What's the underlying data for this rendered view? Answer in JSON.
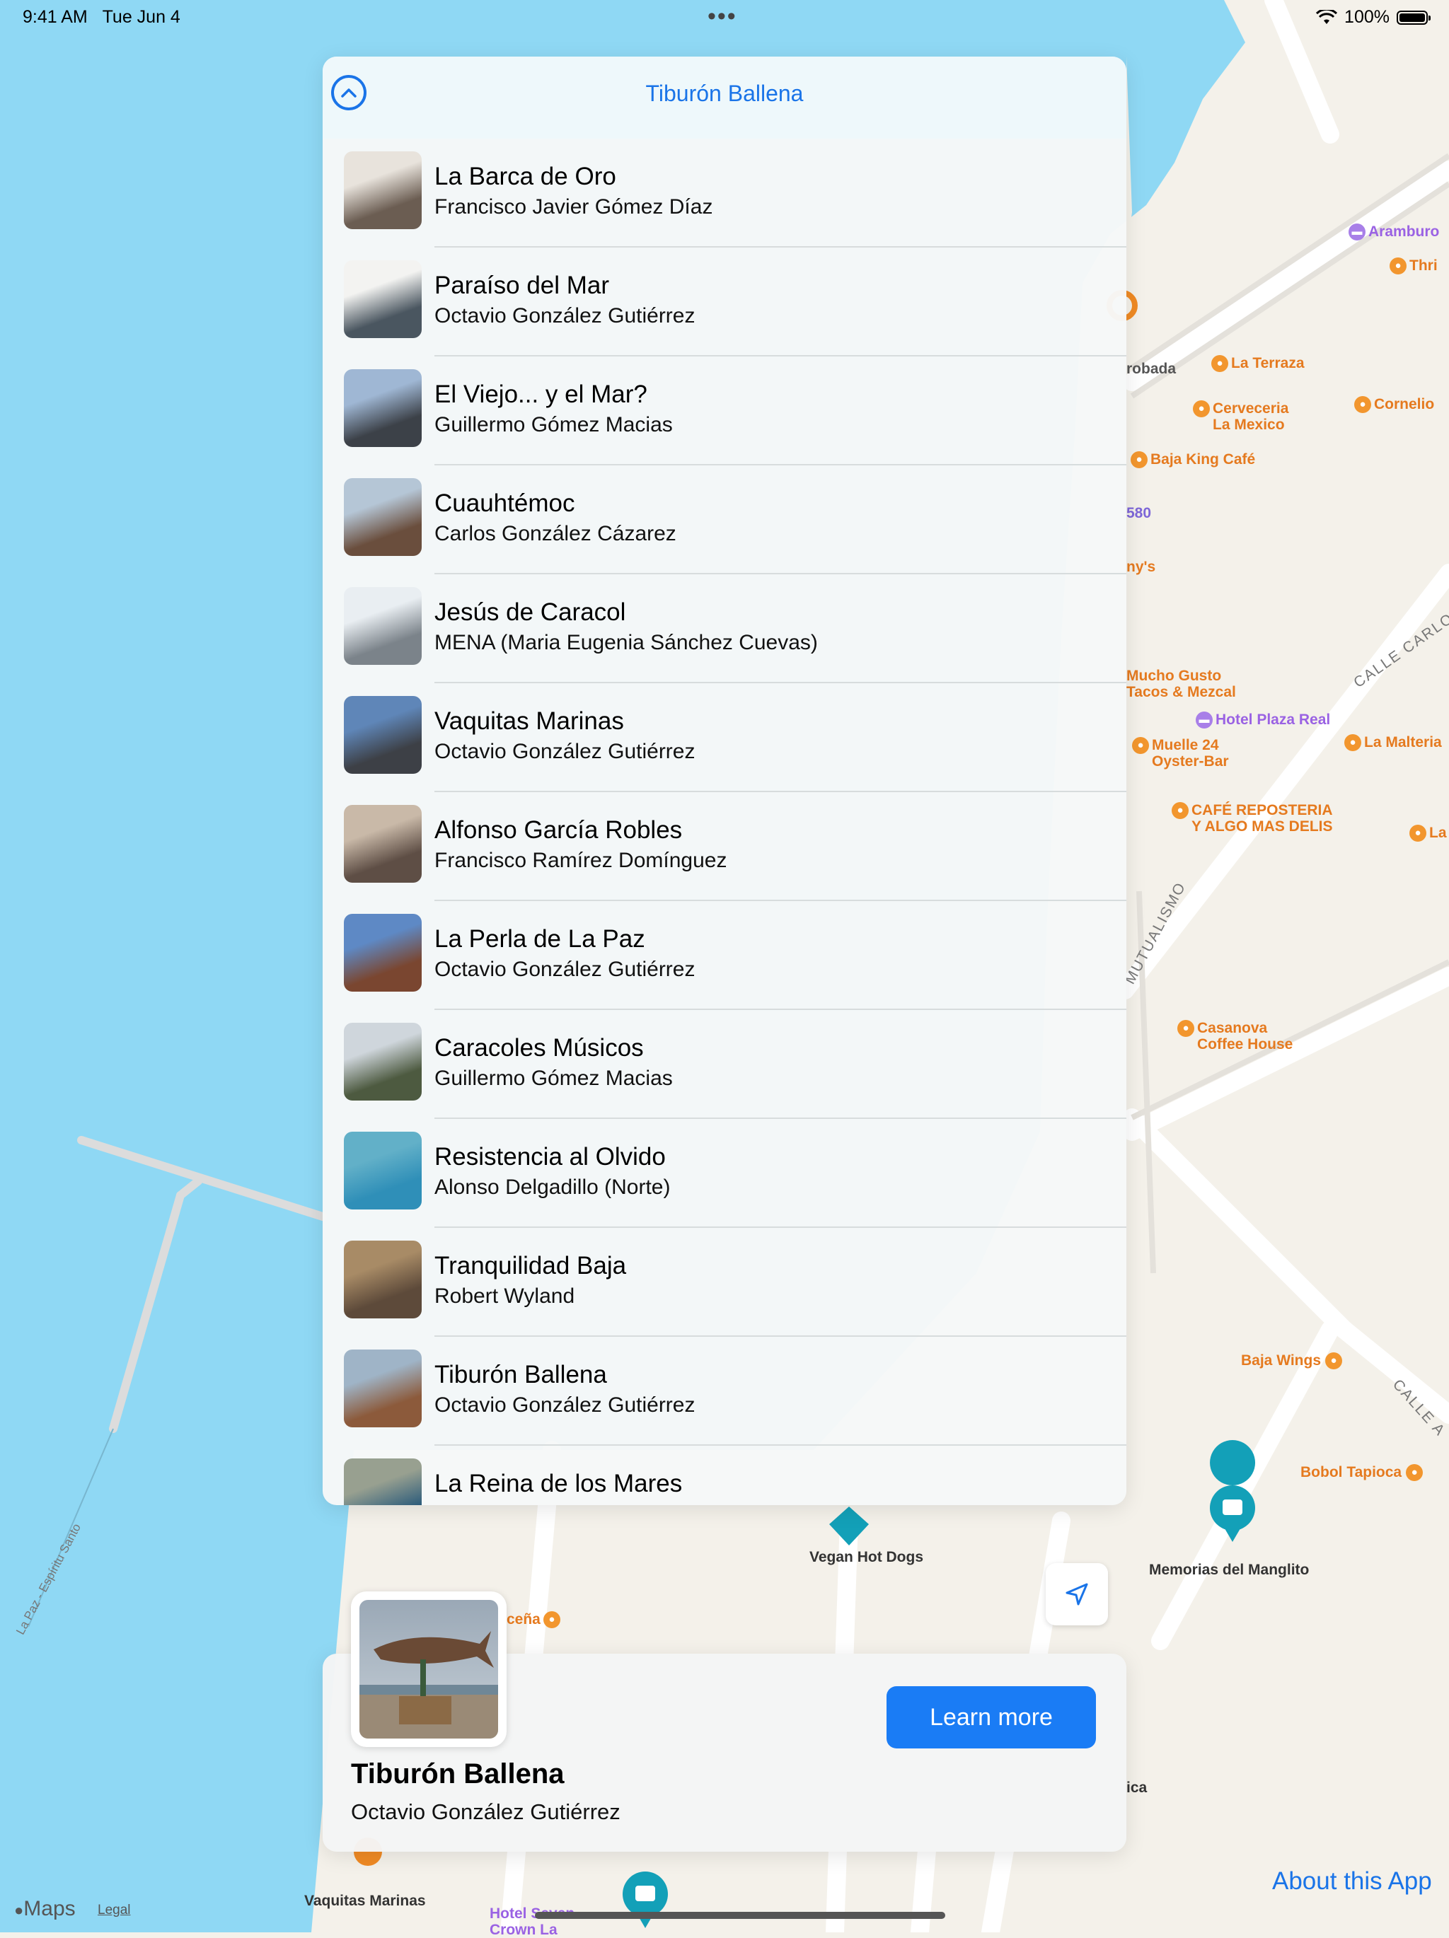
{
  "status_bar": {
    "time": "9:41 AM",
    "date": "Tue Jun 4",
    "battery": "100%"
  },
  "panel": {
    "title": "Tiburón Ballena",
    "items": [
      {
        "title": "La Barca de Oro",
        "artist": "Francisco Javier Gómez Díaz",
        "colors": [
          "#6b5d52",
          "#e8e3dc"
        ]
      },
      {
        "title": "Paraíso del Mar",
        "artist": "Octavio González Gutiérrez",
        "colors": [
          "#4a5660",
          "#f3f3f1"
        ]
      },
      {
        "title": "El Viejo... y el Mar?",
        "artist": "Guillermo Gómez Macias",
        "colors": [
          "#3c4148",
          "#9fb7d4"
        ]
      },
      {
        "title": "Cuauhtémoc",
        "artist": "Carlos González Cázarez",
        "colors": [
          "#6a4e3d",
          "#b5c6d6"
        ]
      },
      {
        "title": "Jesús de Caracol",
        "artist": "MENA (Maria Eugenia Sánchez Cuevas)",
        "colors": [
          "#7b838a",
          "#e9eef2"
        ]
      },
      {
        "title": "Vaquitas Marinas",
        "artist": "Octavio González Gutiérrez",
        "colors": [
          "#3d4046",
          "#5f86b8"
        ]
      },
      {
        "title": "Alfonso García Robles",
        "artist": "Francisco Ramírez Domínguez",
        "colors": [
          "#5e4e45",
          "#c9b9a8"
        ]
      },
      {
        "title": "La Perla de La Paz",
        "artist": "Octavio González Gutiérrez",
        "colors": [
          "#7a4630",
          "#5e89c5"
        ]
      },
      {
        "title": "Caracoles Músicos",
        "artist": "Guillermo Gómez Macias",
        "colors": [
          "#4d5a40",
          "#cfd6dc"
        ]
      },
      {
        "title": "Resistencia al Olvido",
        "artist": "Alonso Delgadillo (Norte)",
        "colors": [
          "#2f8fb8",
          "#62b0c8"
        ]
      },
      {
        "title": "Tranquilidad Baja",
        "artist": "Robert Wyland",
        "colors": [
          "#5d4a3a",
          "#a88b66"
        ]
      },
      {
        "title": "Tiburón Ballena",
        "artist": "Octavio González Gutiérrez",
        "colors": [
          "#8c5a3b",
          "#9fb4c7"
        ]
      },
      {
        "title": "La Reina de los Mares",
        "artist": "",
        "colors": [
          "#2d5c7b",
          "#98a090"
        ]
      }
    ]
  },
  "selected_card": {
    "title": "Tiburón Ballena",
    "artist": "Octavio González Gutiérrez",
    "button_label": "Learn more"
  },
  "map": {
    "pois": [
      {
        "label": "Aramburo",
        "kind": "purple"
      },
      {
        "label": "Thri",
        "kind": "orange"
      },
      {
        "label": "La Terraza",
        "kind": "orange"
      },
      {
        "label": "Cerveceria",
        "line2": "La Mexico",
        "kind": "orange"
      },
      {
        "label": "Cornelio",
        "kind": "orange"
      },
      {
        "label": "Baja King Café",
        "kind": "orange"
      },
      {
        "label": "Hotel Plaza Real",
        "kind": "purple"
      },
      {
        "label": "La Malteria",
        "kind": "orange"
      },
      {
        "label": "Muelle 24",
        "line2": "Oyster-Bar",
        "kind": "orange"
      },
      {
        "label": "CAFÉ REPOSTERIA",
        "line2": "Y ALGO MAS DELIS",
        "kind": "orange"
      },
      {
        "label": "La",
        "kind": "orange"
      },
      {
        "label": "Casanova",
        "line2": "Coffee House",
        "kind": "orange"
      },
      {
        "label": "Baja Wings",
        "kind": "orange"
      },
      {
        "label": "Bobol Tapioca",
        "kind": "orange"
      }
    ],
    "fragments": {
      "probada": "robada",
      "num": "580",
      "nys": "ny's",
      "mucho1": "Mucho Gusto",
      "mucho2": "Tacos & Mezcal",
      "cena": "ceña",
      "ica": "ica",
      "hotel_seven": "Hotel Seven",
      "crown": "Crown La"
    },
    "landmarks": {
      "vegan": "Vegan Hot Dogs",
      "manglito": "Memorias del Manglito",
      "vaquitas": "Vaquitas Marinas"
    },
    "streets": {
      "calle_carlos": "CALLE CARLOS",
      "mutualismo": "MUTUALISMO",
      "calle_a": "CALLE A",
      "malecon": "La Paz - Espíritu Santo"
    }
  },
  "footer": {
    "maps_label": "Maps",
    "legal_label": "Legal",
    "about_label": "About this App"
  }
}
